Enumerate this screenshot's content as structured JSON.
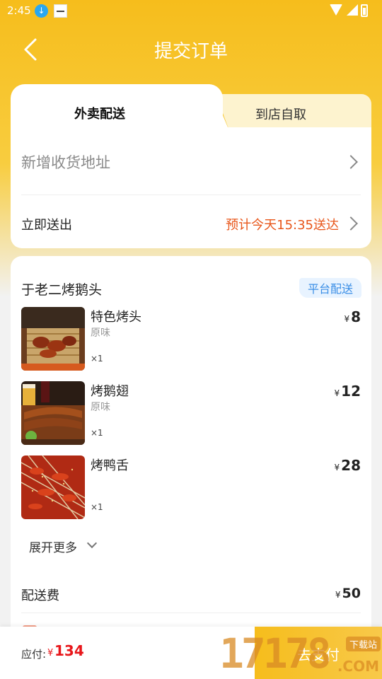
{
  "status_bar": {
    "time": "2:45"
  },
  "header": {
    "title": "提交订单"
  },
  "tabs": [
    {
      "label": "外卖配送",
      "active": true
    },
    {
      "label": "到店自取",
      "active": false
    }
  ],
  "address": {
    "placeholder": "新增收货地址",
    "delivery_mode": "立即送出",
    "eta": "预计今天15:35送达"
  },
  "order": {
    "shop_name": "于老二烤鹅头",
    "delivery_badge": "平台配送",
    "currency": "¥",
    "items": [
      {
        "name": "特色烤头",
        "spec": "原味",
        "qty": "×1",
        "price": "8"
      },
      {
        "name": "烤鹅翅",
        "spec": "原味",
        "qty": "×1",
        "price": "12"
      },
      {
        "name": "烤鸭舌",
        "spec": "",
        "qty": "×1",
        "price": "28"
      }
    ],
    "expand_label": "展开更多",
    "delivery_fee_label": "配送费",
    "delivery_fee": "50"
  },
  "footer": {
    "pay_label": "应付:",
    "currency": "¥",
    "total": "134",
    "submit_label": "去支付"
  },
  "watermark": {
    "digits": "17178",
    "tag": "下载站",
    "domain": ".COM"
  },
  "colors": {
    "accent": "#f6bd1c",
    "price_red": "#e8161a",
    "eta_orange": "#e8561a",
    "badge_blue": "#3a8ee6"
  }
}
